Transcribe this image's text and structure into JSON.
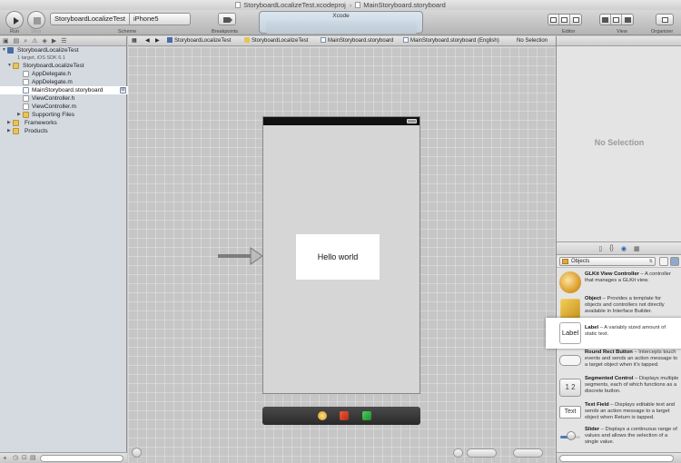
{
  "window": {
    "project_file": "StoryboardLocalizeTest.xcodeproj",
    "separator": "›",
    "storyboard_file": "MainStoryboard.storyboard"
  },
  "toolbar": {
    "run_label": "Run",
    "stop_label": "Stop",
    "scheme_target": "StoryboardLocalizeTest",
    "scheme_device": "iPhone5",
    "scheme_label": "Scheme",
    "breakpoints_label": "Breakpoints",
    "activity_title": "Xcode",
    "editor_label": "Editor",
    "view_label": "View",
    "organizer_label": "Organizer"
  },
  "navigator": {
    "project": {
      "name": "StoryboardLocalizeTest",
      "subtitle": "1 target, iOS SDK 6.1"
    },
    "items": [
      {
        "label": "StoryboardLocalizeTest",
        "kind": "folder"
      },
      {
        "label": "AppDelegate.h",
        "kind": "h"
      },
      {
        "label": "AppDelegate.m",
        "kind": "m"
      },
      {
        "label": "MainStoryboard.storyboard",
        "kind": "storyboard",
        "badge": "M"
      },
      {
        "label": "ViewController.h",
        "kind": "h"
      },
      {
        "label": "ViewController.m",
        "kind": "m"
      },
      {
        "label": "Supporting Files",
        "kind": "folder"
      },
      {
        "label": "Frameworks",
        "kind": "folder"
      },
      {
        "label": "Products",
        "kind": "folder"
      }
    ]
  },
  "jumpbar": {
    "crumbs": [
      "StoryboardLocalizeTest",
      "StoryboardLocalizeTest",
      "MainStoryboard.storyboard",
      "MainStoryboard.storyboard (English)",
      "No Selection"
    ]
  },
  "canvas": {
    "label_text": "Hello world"
  },
  "inspector": {
    "no_selection": "No Selection"
  },
  "library": {
    "filter_selected": "Objects",
    "items": [
      {
        "title": "GLKit View Controller",
        "text": " – A controller that manages a GLKit view."
      },
      {
        "title": "Object",
        "text": " – Provides a template for objects and controllers not directly available in Interface Builder."
      },
      {
        "title": "Label",
        "text": " – A variably sized amount of static text.",
        "thumb": "Label"
      },
      {
        "title": "Round Rect Button",
        "text": " – Intercepts touch events and sends an action message to a target object when it's tapped."
      },
      {
        "title": "Segmented Control",
        "text": " – Displays multiple segments, each of which functions as a discrete button.",
        "thumb": "1 2"
      },
      {
        "title": "Text Field",
        "text": " – Displays editable text and sends an action message to a target object when Return is tapped.",
        "thumb": "Text"
      },
      {
        "title": "Slider",
        "text": " – Displays a continuous range of values and allows the selection of a single value."
      }
    ]
  },
  "colors": {
    "selection": "#ffffff",
    "navigator_bg": "#d5dae1",
    "canvas_bg": "#c6c6c6"
  }
}
